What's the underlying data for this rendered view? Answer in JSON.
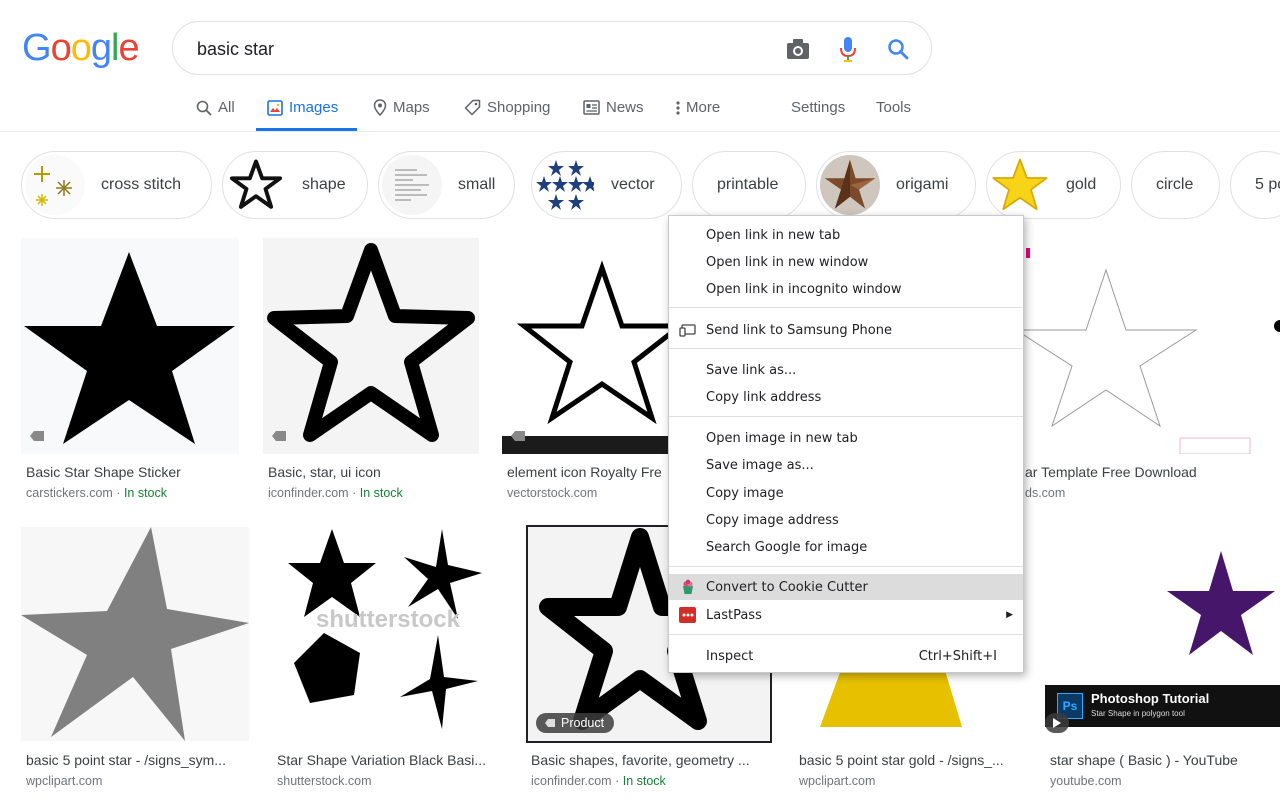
{
  "search": {
    "query": "basic star"
  },
  "tabs": [
    {
      "label": "All",
      "icon": "search-icon"
    },
    {
      "label": "Images",
      "icon": "images-icon"
    },
    {
      "label": "Maps",
      "icon": "map-pin-icon"
    },
    {
      "label": "Shopping",
      "icon": "tag-icon"
    },
    {
      "label": "News",
      "icon": "news-icon"
    },
    {
      "label": "More",
      "icon": "more-vert-icon"
    },
    {
      "label": "Settings"
    },
    {
      "label": "Tools"
    }
  ],
  "chips": [
    {
      "label": "cross stitch"
    },
    {
      "label": "shape"
    },
    {
      "label": "small"
    },
    {
      "label": "vector"
    },
    {
      "label": "printable"
    },
    {
      "label": "origami"
    },
    {
      "label": "gold"
    },
    {
      "label": "circle"
    },
    {
      "label": "5 po"
    }
  ],
  "results_row1": [
    {
      "title": "Basic Star Shape Sticker",
      "source": "carstickers.com",
      "stock": "In stock"
    },
    {
      "title": "Basic, star, ui icon",
      "source": "iconfinder.com",
      "stock": "In stock"
    },
    {
      "title": "element icon Royalty Fre",
      "source": "vectorstock.com"
    },
    {
      "title": "ar Template Free Download",
      "source": "ds.com"
    }
  ],
  "results_row2": [
    {
      "title": "basic 5 point star - /signs_sym...",
      "source": "wpclipart.com"
    },
    {
      "title": "Star Shape Variation Black Basi...",
      "source": "shutterstock.com",
      "watermark": "shutterstock"
    },
    {
      "title": "Basic shapes, favorite, geometry ...",
      "source": "iconfinder.com",
      "stock": "In stock",
      "badge": "Product"
    },
    {
      "title": "basic 5 point star gold - /signs_...",
      "source": "wpclipart.com"
    },
    {
      "title": "star shape ( Basic ) - YouTube",
      "source": "youtube.com",
      "banner_title": "Photoshop Tutorial",
      "banner_sub": "Star Shape in polygon tool"
    }
  ],
  "context_menu": {
    "items": [
      {
        "label": "Open link in new tab"
      },
      {
        "label": "Open link in new window"
      },
      {
        "label": "Open link in incognito window"
      },
      {
        "label": "Send link to Samsung Phone",
        "icon": "device-icon"
      },
      {
        "label": "Save link as..."
      },
      {
        "label": "Copy link address"
      },
      {
        "label": "Open image in new tab"
      },
      {
        "label": "Save image as..."
      },
      {
        "label": "Copy image"
      },
      {
        "label": "Copy image address"
      },
      {
        "label": "Search Google for image"
      },
      {
        "label": "Convert to Cookie Cutter",
        "icon": "cookie-cutter-icon"
      },
      {
        "label": "LastPass",
        "icon": "lastpass-icon"
      },
      {
        "label": "Inspect",
        "shortcut": "Ctrl+Shift+I"
      }
    ]
  },
  "colors": {
    "accent": "#1a73e8",
    "in_stock": "#188038",
    "purple_star": "#46166b",
    "gold_star": "#e7c000"
  }
}
